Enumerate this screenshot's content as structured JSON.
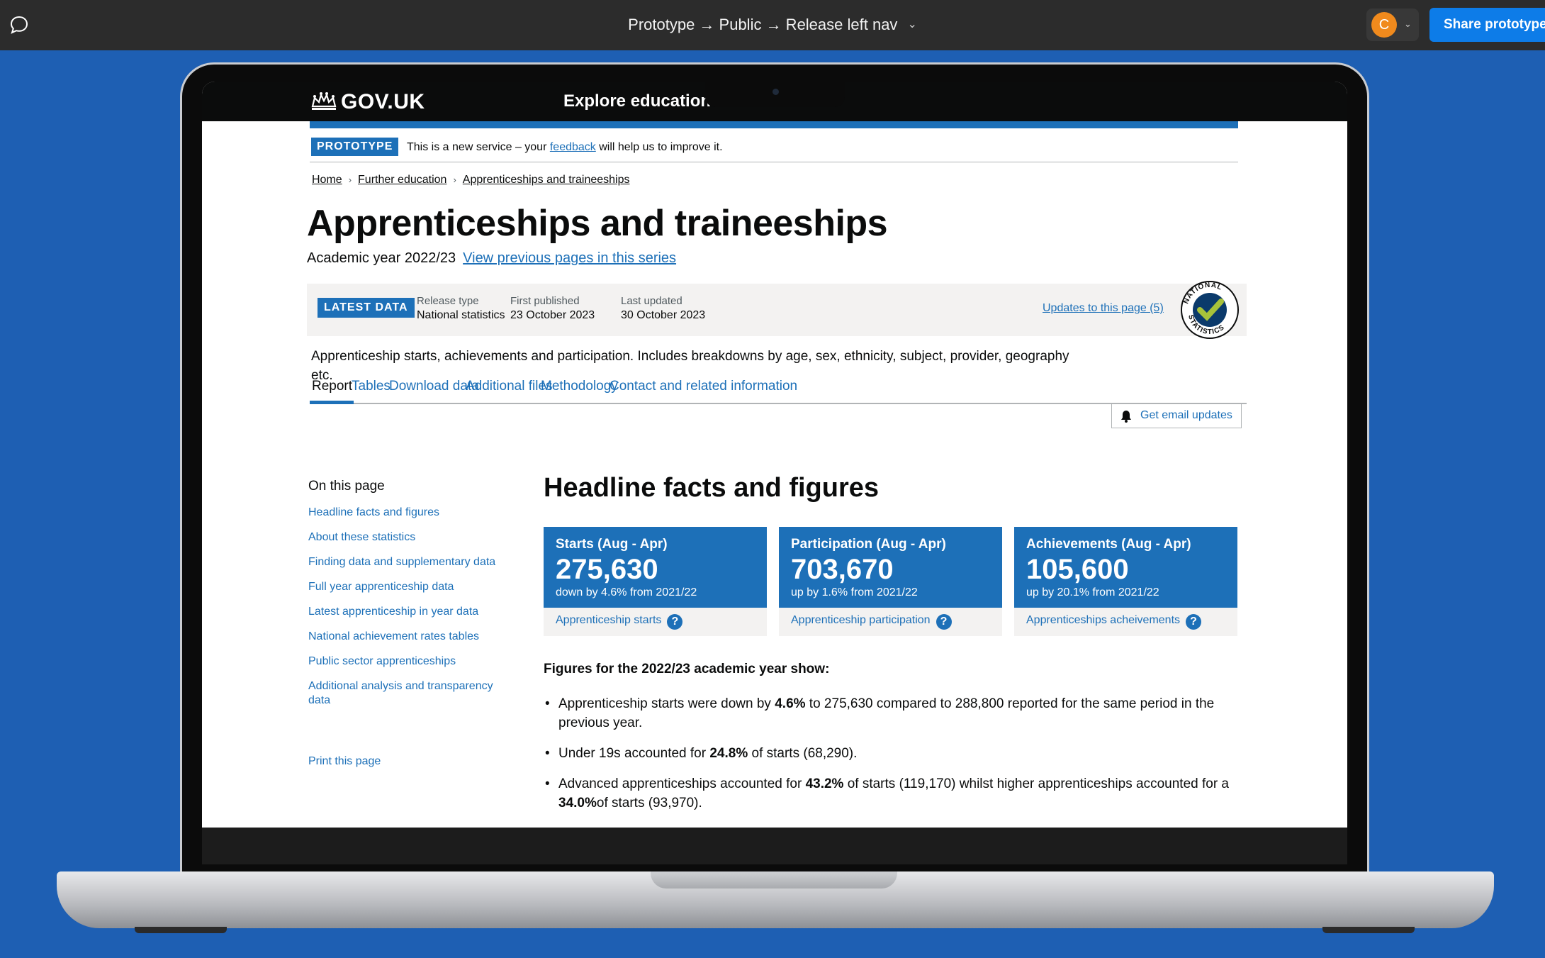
{
  "topbar": {
    "breadcrumb": "Prototype → Public → Release left nav",
    "avatar_initial": "C",
    "share_label": "Share prototype"
  },
  "header": {
    "logo": "GOV.UK",
    "service_name": "Explore education statistics"
  },
  "phase_banner": {
    "tag": "PROTOTYPE",
    "text_before": "This is a new service – your ",
    "link": "feedback",
    "text_after": " will help us to improve it."
  },
  "breadcrumbs": [
    "Home",
    "Further education",
    "Apprenticeships and traineeships"
  ],
  "page": {
    "title": "Apprenticeships and traineeships",
    "academic_year": "Academic year 2022/23",
    "series_link": "View previous pages in this series",
    "summary": "Apprenticeship starts, achievements and participation. Includes breakdowns by age, sex, ethnicity, subject, provider, geography etc."
  },
  "release": {
    "badge": "LATEST DATA",
    "release_type_label": "Release type",
    "release_type": "National statistics",
    "first_published_label": "First published",
    "first_published": "23 October 2023",
    "last_updated_label": "Last updated",
    "last_updated": "30 October 2023",
    "updates_link": "Updates to this page (5)",
    "badge_text": "NATIONAL STATISTICS"
  },
  "tabs": [
    "Report",
    "Tables",
    "Download data",
    "Additional files",
    "Methodology",
    "Contact and related information"
  ],
  "email_button": "Get email updates",
  "on_this_page": {
    "title": "On this page",
    "items": [
      "Headline facts and figures",
      "About these statistics",
      "Finding data and supplementary data",
      "Full year apprenticeship data",
      "Latest apprenticeship in year data",
      "National achievement rates tables",
      "Public sector apprenticeships",
      "Additional analysis and transparency data"
    ],
    "print": "Print this page"
  },
  "headline": {
    "title": "Headline facts and figures",
    "cards": [
      {
        "title": "Starts (Aug - Apr)",
        "value": "275,630",
        "change": "down by 4.6% from 2021/22",
        "link": "Apprenticeship starts"
      },
      {
        "title": "Participation (Aug - Apr)",
        "value": "703,670",
        "change": "up by 1.6% from 2021/22",
        "link": "Apprenticeship participation"
      },
      {
        "title": "Achievements (Aug - Apr)",
        "value": "105,600",
        "change": "up by 20.1% from 2021/22",
        "link": "Apprenticeships acheivements"
      }
    ],
    "figures_title": "Figures for the 2022/23 academic year show:",
    "bullets": [
      {
        "a": "Apprenticeship starts were down by ",
        "b": "4.6%",
        "c": " to 275,630 compared to 288,800 reported for the same period in the previous year.",
        "d": "",
        "e": ""
      },
      {
        "a": "Under 19s accounted for ",
        "b": "24.8%",
        "c": " of starts (68,290).",
        "d": "",
        "e": ""
      },
      {
        "a": "Advanced apprenticeships accounted for ",
        "b": "43.2%",
        "c": " of starts (119,170) whilst higher apprenticeships accounted for a ",
        "d": "34.0%",
        "e": "of starts (93,970)."
      }
    ]
  },
  "colors": {
    "brand_blue": "#1d70b8",
    "background_blue": "#1e5fb3",
    "topbar": "#2c2c2c",
    "share_button": "#0d7ce8",
    "avatar": "#f08a1d"
  }
}
